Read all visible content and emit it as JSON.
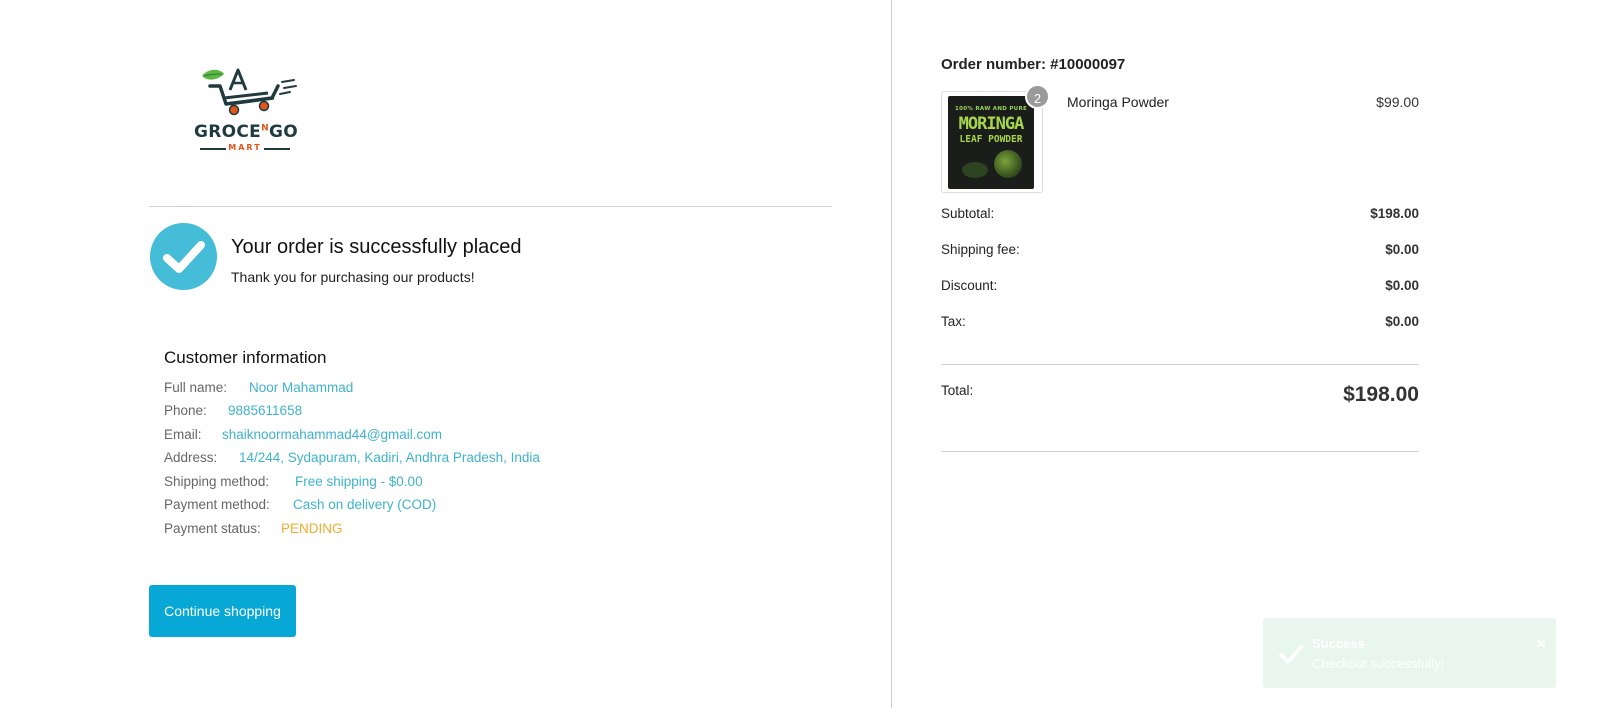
{
  "brand": {
    "logo_text_main": "GROCE",
    "logo_text_n": "N",
    "logo_text_end": "GO",
    "logo_sub": "MART",
    "accent_color": "#45bcd8"
  },
  "success": {
    "icon": "check-circle-icon",
    "title": "Your order is successfully placed",
    "subtitle": "Thank you for purchasing our products!"
  },
  "customer": {
    "title": "Customer information",
    "fields": [
      {
        "label": "Full name:",
        "value": "Noor Mahammad"
      },
      {
        "label": "Phone:",
        "value": "9885611658"
      },
      {
        "label": "Email:",
        "value": "shaiknoormahammad44@gmail.com"
      },
      {
        "label": "Address:",
        "value": "14/244, Sydapuram, Kadiri, Andhra Pradesh, India"
      },
      {
        "label": "Shipping method:",
        "value": "Free shipping - $0.00"
      },
      {
        "label": "Payment method:",
        "value": "Cash on delivery (COD)"
      },
      {
        "label": "Payment status:",
        "value": "PENDING"
      }
    ]
  },
  "actions": {
    "continue_label": "Continue shopping"
  },
  "order": {
    "number_label": "Order number: #10000097",
    "item": {
      "name": "Moringa Powder",
      "price": "$99.00",
      "quantity": "2",
      "image_text_top": "100% RAW AND PURE",
      "image_text_main": "MORINGA",
      "image_text_sub": "LEAF POWDER"
    },
    "summary": [
      {
        "label": "Subtotal:",
        "amount": "$198.00"
      },
      {
        "label": "Shipping fee:",
        "amount": "$0.00"
      },
      {
        "label": "Discount:",
        "amount": "$0.00"
      },
      {
        "label": "Tax:",
        "amount": "$0.00"
      }
    ],
    "total_label": "Total:",
    "total_amount": "$198.00"
  },
  "toast": {
    "icon": "check-icon",
    "title": "Success",
    "message": "Checkout successfully!",
    "close": "×"
  }
}
